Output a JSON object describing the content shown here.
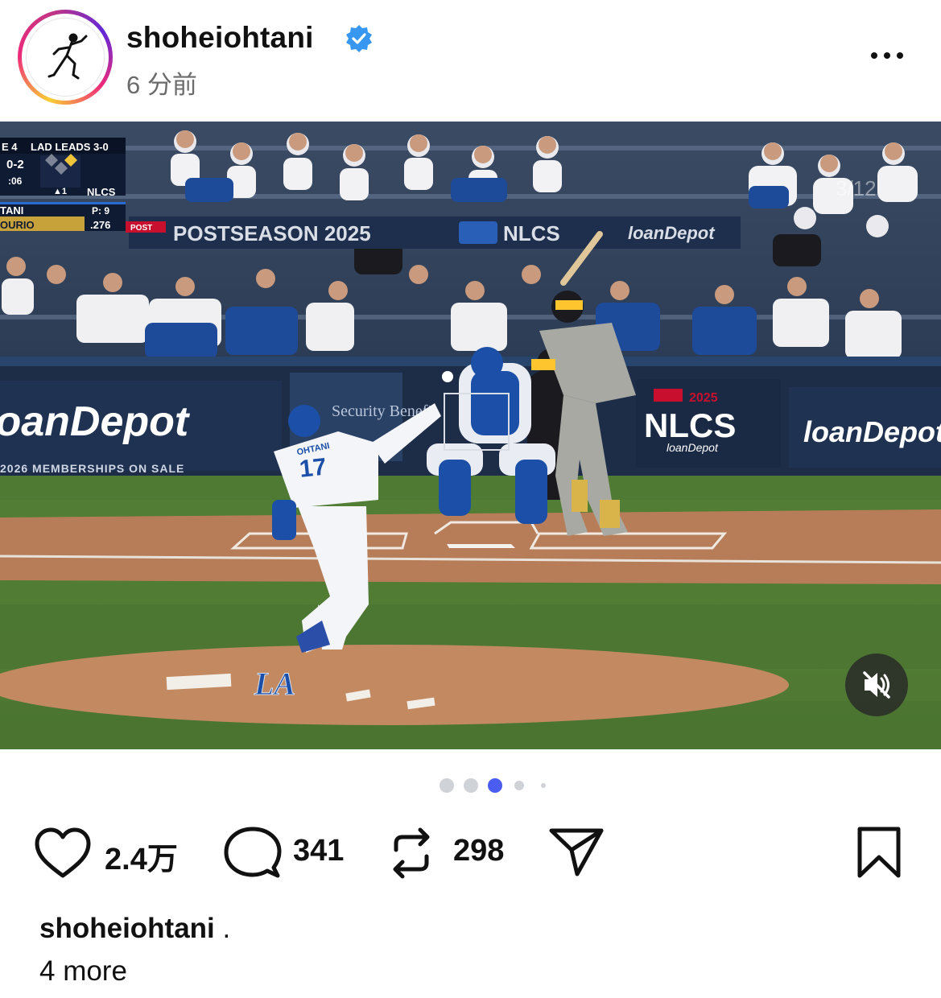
{
  "post": {
    "username": "shoheiohtani",
    "verified": true,
    "timestamp": "6 分前",
    "menu_icon": "more-horizontal-icon"
  },
  "media": {
    "counter": "3/12",
    "mute_icon": "speaker-muted-icon",
    "scorebug": {
      "game": "E 4",
      "series": "LAD LEADS 3-0",
      "count": "0-2",
      "clock": ":06",
      "outs": "▲1",
      "network": "NLCS",
      "pitcher": "TANI",
      "pitch_count": "P: 9",
      "batter": "OURIO",
      "avg": ".276",
      "tag": "POST"
    },
    "signage": {
      "banner_postseason": "POSTSEASON 2025",
      "banner_nlcs": "NLCS",
      "banner_sponsor": "loanDepot",
      "wall_left": "loanDepot",
      "wall_sub": "2026 MEMBERSHIPS ON SALE",
      "security": "Security Benefit",
      "nlcs_year": "2025",
      "nlcs_wall": "NLCS",
      "nlcs_sub": "loanDepot",
      "wall_right": "loanDepot",
      "jersey_name": "OHTANI",
      "jersey_number": "17",
      "mound_logo": "LA"
    }
  },
  "carousel": {
    "total": 5,
    "active": 2
  },
  "actions": {
    "like": {
      "icon": "heart-icon",
      "count": "2.4万"
    },
    "comment": {
      "icon": "comment-icon",
      "count": "341"
    },
    "repost": {
      "icon": "repost-icon",
      "count": "298"
    },
    "share": {
      "icon": "send-icon"
    },
    "save": {
      "icon": "bookmark-icon"
    }
  },
  "caption": {
    "username": "shoheiohtani",
    "text": " .",
    "more": "4 more"
  },
  "colors": {
    "verified": "#3897f0",
    "active_dot": "#4a5df0",
    "inactive_dot": "#cfd3d8",
    "dodger_blue": "#1b4fa8"
  }
}
